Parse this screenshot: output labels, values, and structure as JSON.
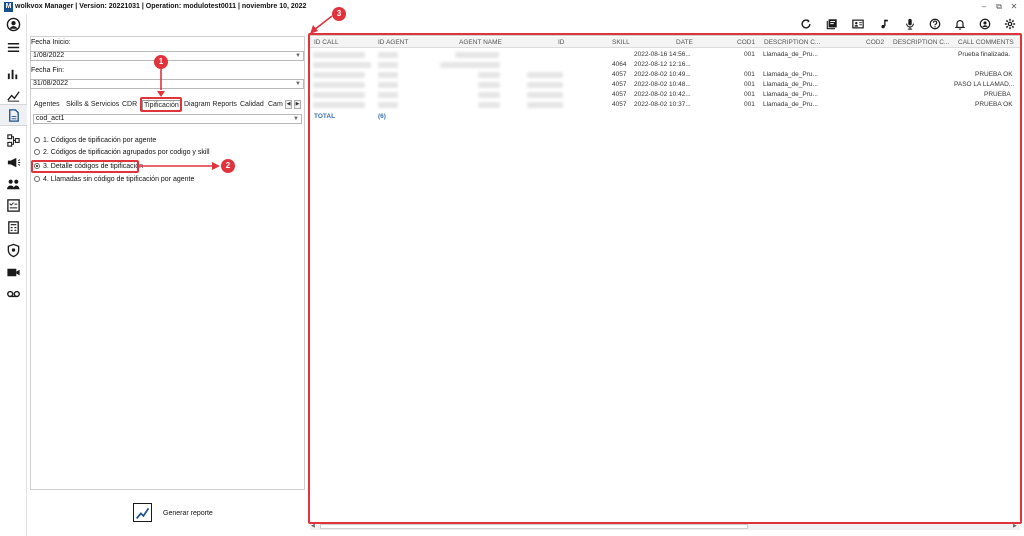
{
  "window": {
    "logo_letter": "M",
    "title": "wolkvox Manager  | Version: 20221031 |  Operation: modulotest0011 | noviembre 10, 2022",
    "minimize": "–",
    "restore": "⧉",
    "close": "✕"
  },
  "filters": {
    "fecha_inicio_label": "Fecha Inicio:",
    "fecha_inicio_value": "1/08/2022",
    "fecha_fin_label": "Fecha Fin:",
    "fecha_fin_value": "31/08/2022",
    "tabs": [
      "Agentes",
      "Skills & Servicios",
      "CDR",
      "Tipificación",
      "Diagram Reports",
      "Calidad",
      "Cam"
    ],
    "active_tab": "Tipificación",
    "code_select_value": "cod_act1",
    "options": [
      "1. Códigos de tipificación por agente",
      "2. Códigos de tipificación agrupados por codigo y skill",
      "3. Detalle códigos de tipificación",
      "4. Llamadas sin código de tipificación por agente"
    ],
    "selected_option": 2,
    "generate_label": "Generar reporte"
  },
  "grid": {
    "columns": [
      "ID CALL",
      "ID AGENT",
      "AGENT NAME",
      "ID",
      "SKILL",
      "DATE",
      "COD1",
      "DESCRIPTION C...",
      "COD2",
      "DESCRIPTION C...",
      "CALL COMMENTS"
    ],
    "rows": [
      {
        "skill": "",
        "date": "2022-08-16 14:56...",
        "cod1": "001",
        "desc1": "Llamada_de_Pru...",
        "comments": "Prueba finalizada."
      },
      {
        "skill": "4064",
        "date": "2022-08-12 12:16...",
        "cod1": "",
        "desc1": "",
        "comments": ""
      },
      {
        "skill": "4057",
        "date": "2022-08-02 10:49...",
        "cod1": "001",
        "desc1": "Llamada_de_Pru...",
        "comments": "PRUEBA OK"
      },
      {
        "skill": "4057",
        "date": "2022-08-02 10:48...",
        "cod1": "001",
        "desc1": "Llamada_de_Pru...",
        "comments": "PASO LA LLAMAD..."
      },
      {
        "skill": "4057",
        "date": "2022-08-02 10:42...",
        "cod1": "001",
        "desc1": "Llamada_de_Pru...",
        "comments": "PRUEBA"
      },
      {
        "skill": "4057",
        "date": "2022-08-02 10:37...",
        "cod1": "001",
        "desc1": "Llamada_de_Pru...",
        "comments": "PRUEBA OK"
      }
    ],
    "total_label": "TOTAL",
    "total_count": "(6)"
  },
  "annotations": {
    "badge1": "1",
    "badge2": "2",
    "badge3": "3",
    "accent": "#e0333c"
  }
}
